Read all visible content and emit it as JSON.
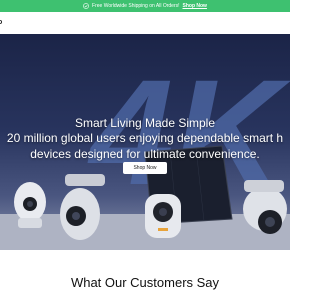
{
  "announcement": {
    "text": "Free Worldwide Shipping on All Orders!",
    "link_label": "Shop Now",
    "bg_color": "#3ec170"
  },
  "nav": {
    "logo_fragment": "o"
  },
  "hero": {
    "background_text": "4K",
    "title": "Smart Living Made Simple",
    "subtitle_line1": "20 million global users enjoying dependable smart h",
    "subtitle_line2": "devices designed for ultimate convenience.",
    "button_label": "Shop Now"
  },
  "testimonials": {
    "heading": "What Our Customers Say"
  }
}
